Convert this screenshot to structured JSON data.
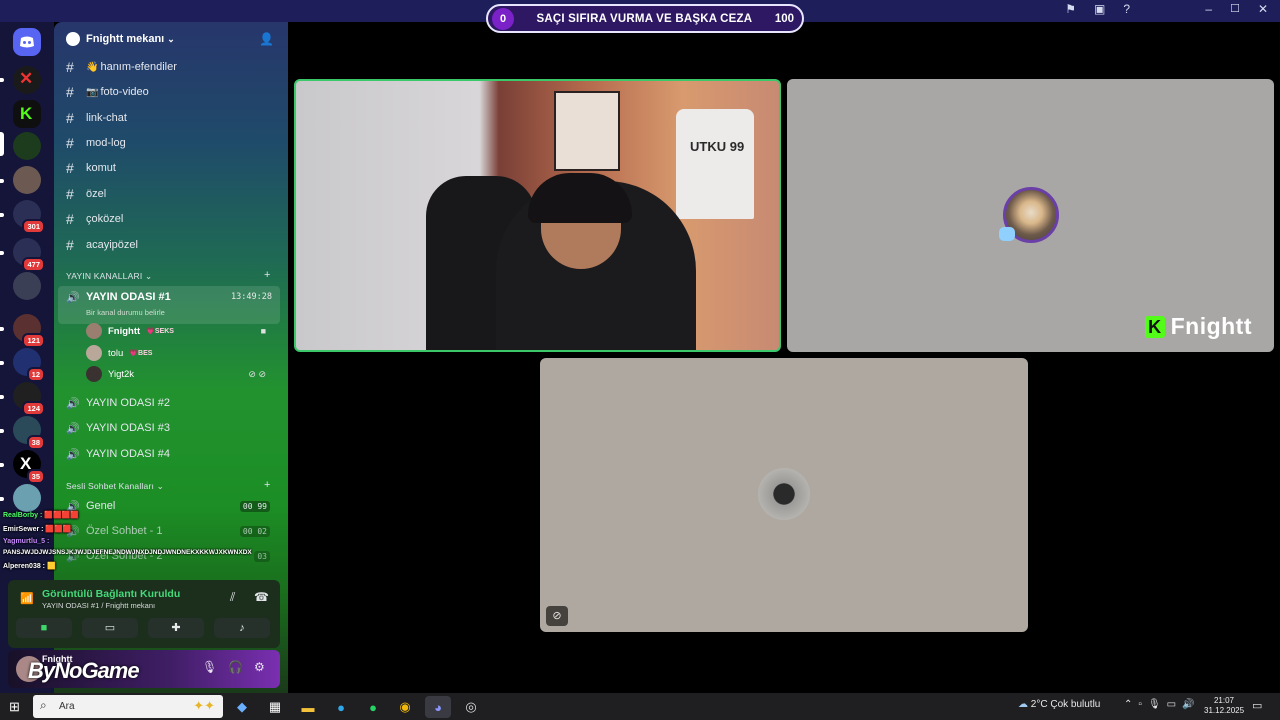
{
  "window": {
    "title": "Fnightt mekanı",
    "title_icons": [
      "flag-icon",
      "screen-icon",
      "help-icon"
    ],
    "controls": [
      "minimize",
      "maximize",
      "close"
    ]
  },
  "overlay": {
    "left_value": "0",
    "title": "SAÇI SIFIRA VURMA VE BAŞKA CEZA",
    "right_value": "100",
    "accent": "#7a22c8"
  },
  "rail": {
    "badges": [
      "301",
      "477",
      "121",
      "12",
      "124",
      "38",
      "35"
    ]
  },
  "sidebar": {
    "server_name": "Fnightt mekanı",
    "text_channels": [
      {
        "emoji": "👋",
        "name": "hanım-efendiler"
      },
      {
        "emoji": "📷",
        "name": "foto-video"
      },
      {
        "emoji": "",
        "name": "link-chat"
      },
      {
        "emoji": "",
        "name": "mod-log"
      },
      {
        "emoji": "",
        "name": "komut"
      },
      {
        "emoji": "",
        "name": "özel"
      },
      {
        "emoji": "",
        "name": "çoközel"
      },
      {
        "emoji": "",
        "name": "acayipözel"
      }
    ],
    "category_stream": "YAYIN KANALLARI",
    "active_voice": {
      "name": "YAYIN ODASI #1",
      "timer": "13:49:28",
      "status": "Bir kanal durumu belirle"
    },
    "voice_users": [
      {
        "name": "Fnightt",
        "tag": "💗SEKS"
      },
      {
        "name": "tolu",
        "tag": "💗BES"
      },
      {
        "name": "Yigt2k",
        "tag": ""
      }
    ],
    "stream_rooms": [
      "YAYIN ODASI #2",
      "YAYIN ODASI #3",
      "YAYIN ODASI #4"
    ],
    "category_voice": "Sesli Sohbet Kanalları",
    "voice_rooms": [
      {
        "name": "Genel",
        "a": "00",
        "b": "99"
      },
      {
        "name": "Özel Sohbet - 1",
        "a": "00",
        "b": "02"
      },
      {
        "name": "Özel Sohbet - 2",
        "a": "",
        "b": "03"
      }
    ]
  },
  "chat_overlay": [
    {
      "user": "RealBorby :",
      "msg": "🟥🟥🟥🟥",
      "color": "#4dff6a"
    },
    {
      "user": "EmirSewer :",
      "msg": "🟥🟥🟥",
      "color": "#ffffff"
    },
    {
      "user": "Yagmurtlu_5 :",
      "msg": "",
      "color": "#c88cff"
    },
    {
      "user": "",
      "msg": "PANSJWJDJWJSNSJKJWJDJEFNEJNDWJNXDJNDJWNDNEKXKKWJXKWNXDX",
      "color": "#ffffff"
    },
    {
      "user": "Alperen038 :",
      "msg": "🟨",
      "color": "#ffffff"
    }
  ],
  "voice_connection": {
    "status": "Görüntülü Bağlantı Kuruldu",
    "channel": "YAYIN ODASI #1 / Fnightt mekanı"
  },
  "user_panel": {
    "name": "Fnightt",
    "logo_text": "ByNoGame"
  },
  "stage": {
    "shirt_text": "UTKU 99",
    "brand": "Fnightt",
    "brand_color": "#53fc18"
  },
  "taskbar": {
    "search_placeholder": "Ara",
    "weather": "2°C  Çok bulutlu",
    "time": "21:07",
    "date": "31.12.2025"
  }
}
